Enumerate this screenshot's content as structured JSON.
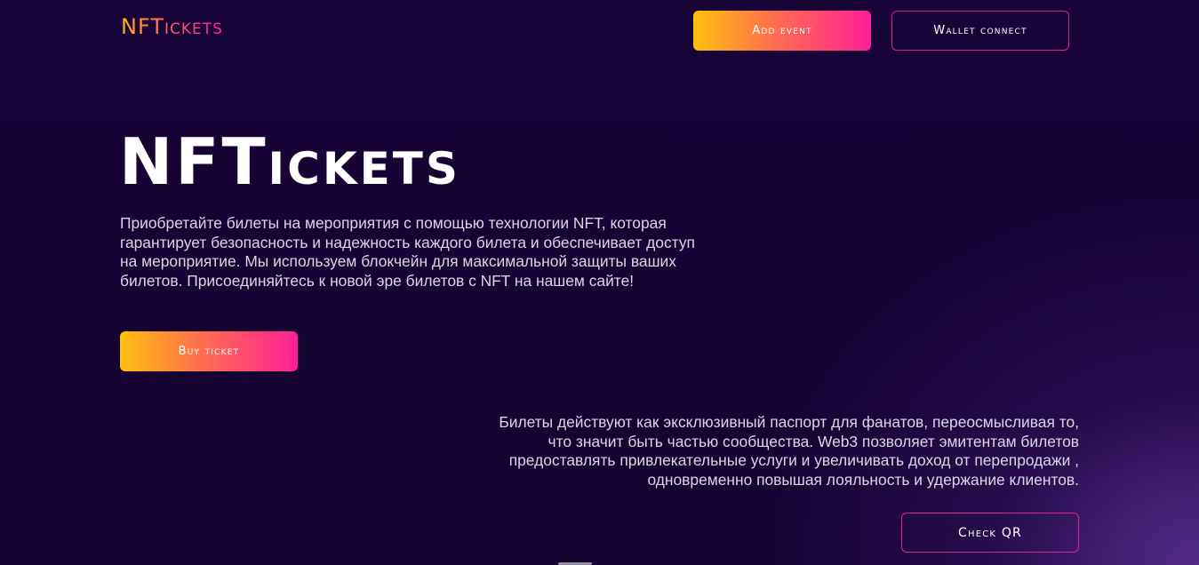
{
  "header": {
    "logo": "NFTickets",
    "add_event_label": "Add event",
    "wallet_connect_label": "Wallet connect"
  },
  "hero": {
    "title": "NFTickets",
    "description": "Приобретайте билеты на мероприятия с помощью технологии NFT, которая гарантирует безопасность и надежность каждого билета и обеспечивает доступ на мероприятие. Мы используем блокчейн для максимальной защиты ваших билетов. Присоединяйтесь к новой эре билетов с NFT на нашем сайте!",
    "buy_ticket_label": "Buy ticket"
  },
  "secondary": {
    "description": "Билеты действуют как эксклюзивный паспорт для фанатов, переосмысливая то, что значит быть частью сообщества. Web3 позволяет эмитентам билетов предоставлять привлекательные услуги и увеличивать доход от перепродажи , одновременно повышая лояльность и удержание клиентов.",
    "check_qr_label": "Check QR"
  },
  "colors": {
    "background": "#160431",
    "accent_start": "#ffc00e",
    "accent_end": "#ff1f96",
    "outline": "#e0208a"
  }
}
